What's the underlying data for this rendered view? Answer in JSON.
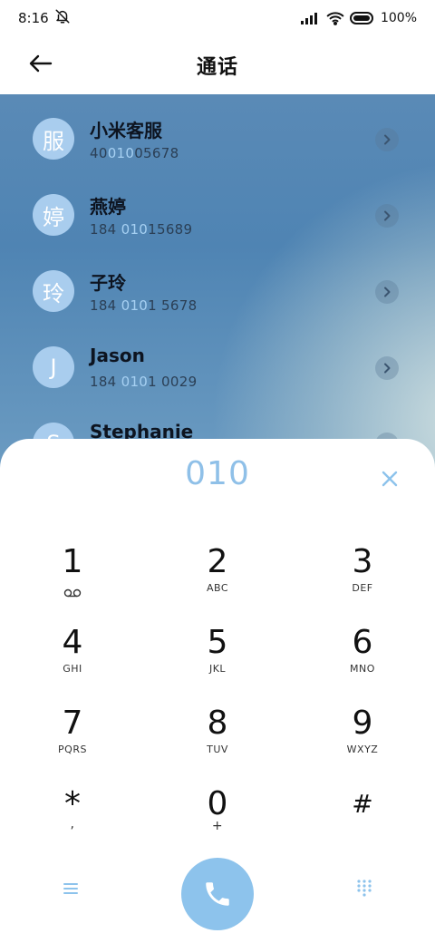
{
  "status_bar": {
    "time": "8:16",
    "battery": "100%"
  },
  "header": {
    "title": "通话"
  },
  "contacts": [
    {
      "initial": "服",
      "name": "小米客服",
      "number_pre": "40",
      "number_hl": "010",
      "number_post": "05678"
    },
    {
      "initial": "婷",
      "name": "燕婷",
      "number_pre": "184 ",
      "number_hl": "010",
      "number_post": "15689"
    },
    {
      "initial": "玲",
      "name": "子玲",
      "number_pre": "184 ",
      "number_hl": "010",
      "number_post": "1 5678"
    },
    {
      "initial": "J",
      "name": "Jason",
      "number_pre": "184 ",
      "number_hl": "010",
      "number_post": "1 0029"
    },
    {
      "initial": "S",
      "name": "Stephanie",
      "number_pre": "",
      "number_hl": "",
      "number_post": ""
    }
  ],
  "dialer": {
    "number": "010",
    "keys": [
      {
        "digit": "1",
        "letters": ""
      },
      {
        "digit": "2",
        "letters": "ABC"
      },
      {
        "digit": "3",
        "letters": "DEF"
      },
      {
        "digit": "4",
        "letters": "GHI"
      },
      {
        "digit": "5",
        "letters": "JKL"
      },
      {
        "digit": "6",
        "letters": "MNO"
      },
      {
        "digit": "7",
        "letters": "PQRS"
      },
      {
        "digit": "8",
        "letters": "TUV"
      },
      {
        "digit": "9",
        "letters": "WXYZ"
      },
      {
        "digit": "*",
        "letters": ","
      },
      {
        "digit": "0",
        "letters": "+"
      },
      {
        "digit": "#",
        "letters": ""
      }
    ]
  },
  "colors": {
    "accent": "#8dc3ec",
    "number_highlight": "#a6d0f2",
    "avatar": "#a9cdee"
  },
  "icons": {
    "back": "arrow-left-icon",
    "mute": "bell-off-icon",
    "signal": "signal-icon",
    "wifi": "wifi-icon",
    "battery": "battery-icon",
    "chevron": "chevron-right-icon",
    "clear": "close-icon",
    "menu": "menu-icon",
    "call": "phone-icon",
    "keypad": "dialpad-icon",
    "voicemail": "voicemail-icon"
  }
}
